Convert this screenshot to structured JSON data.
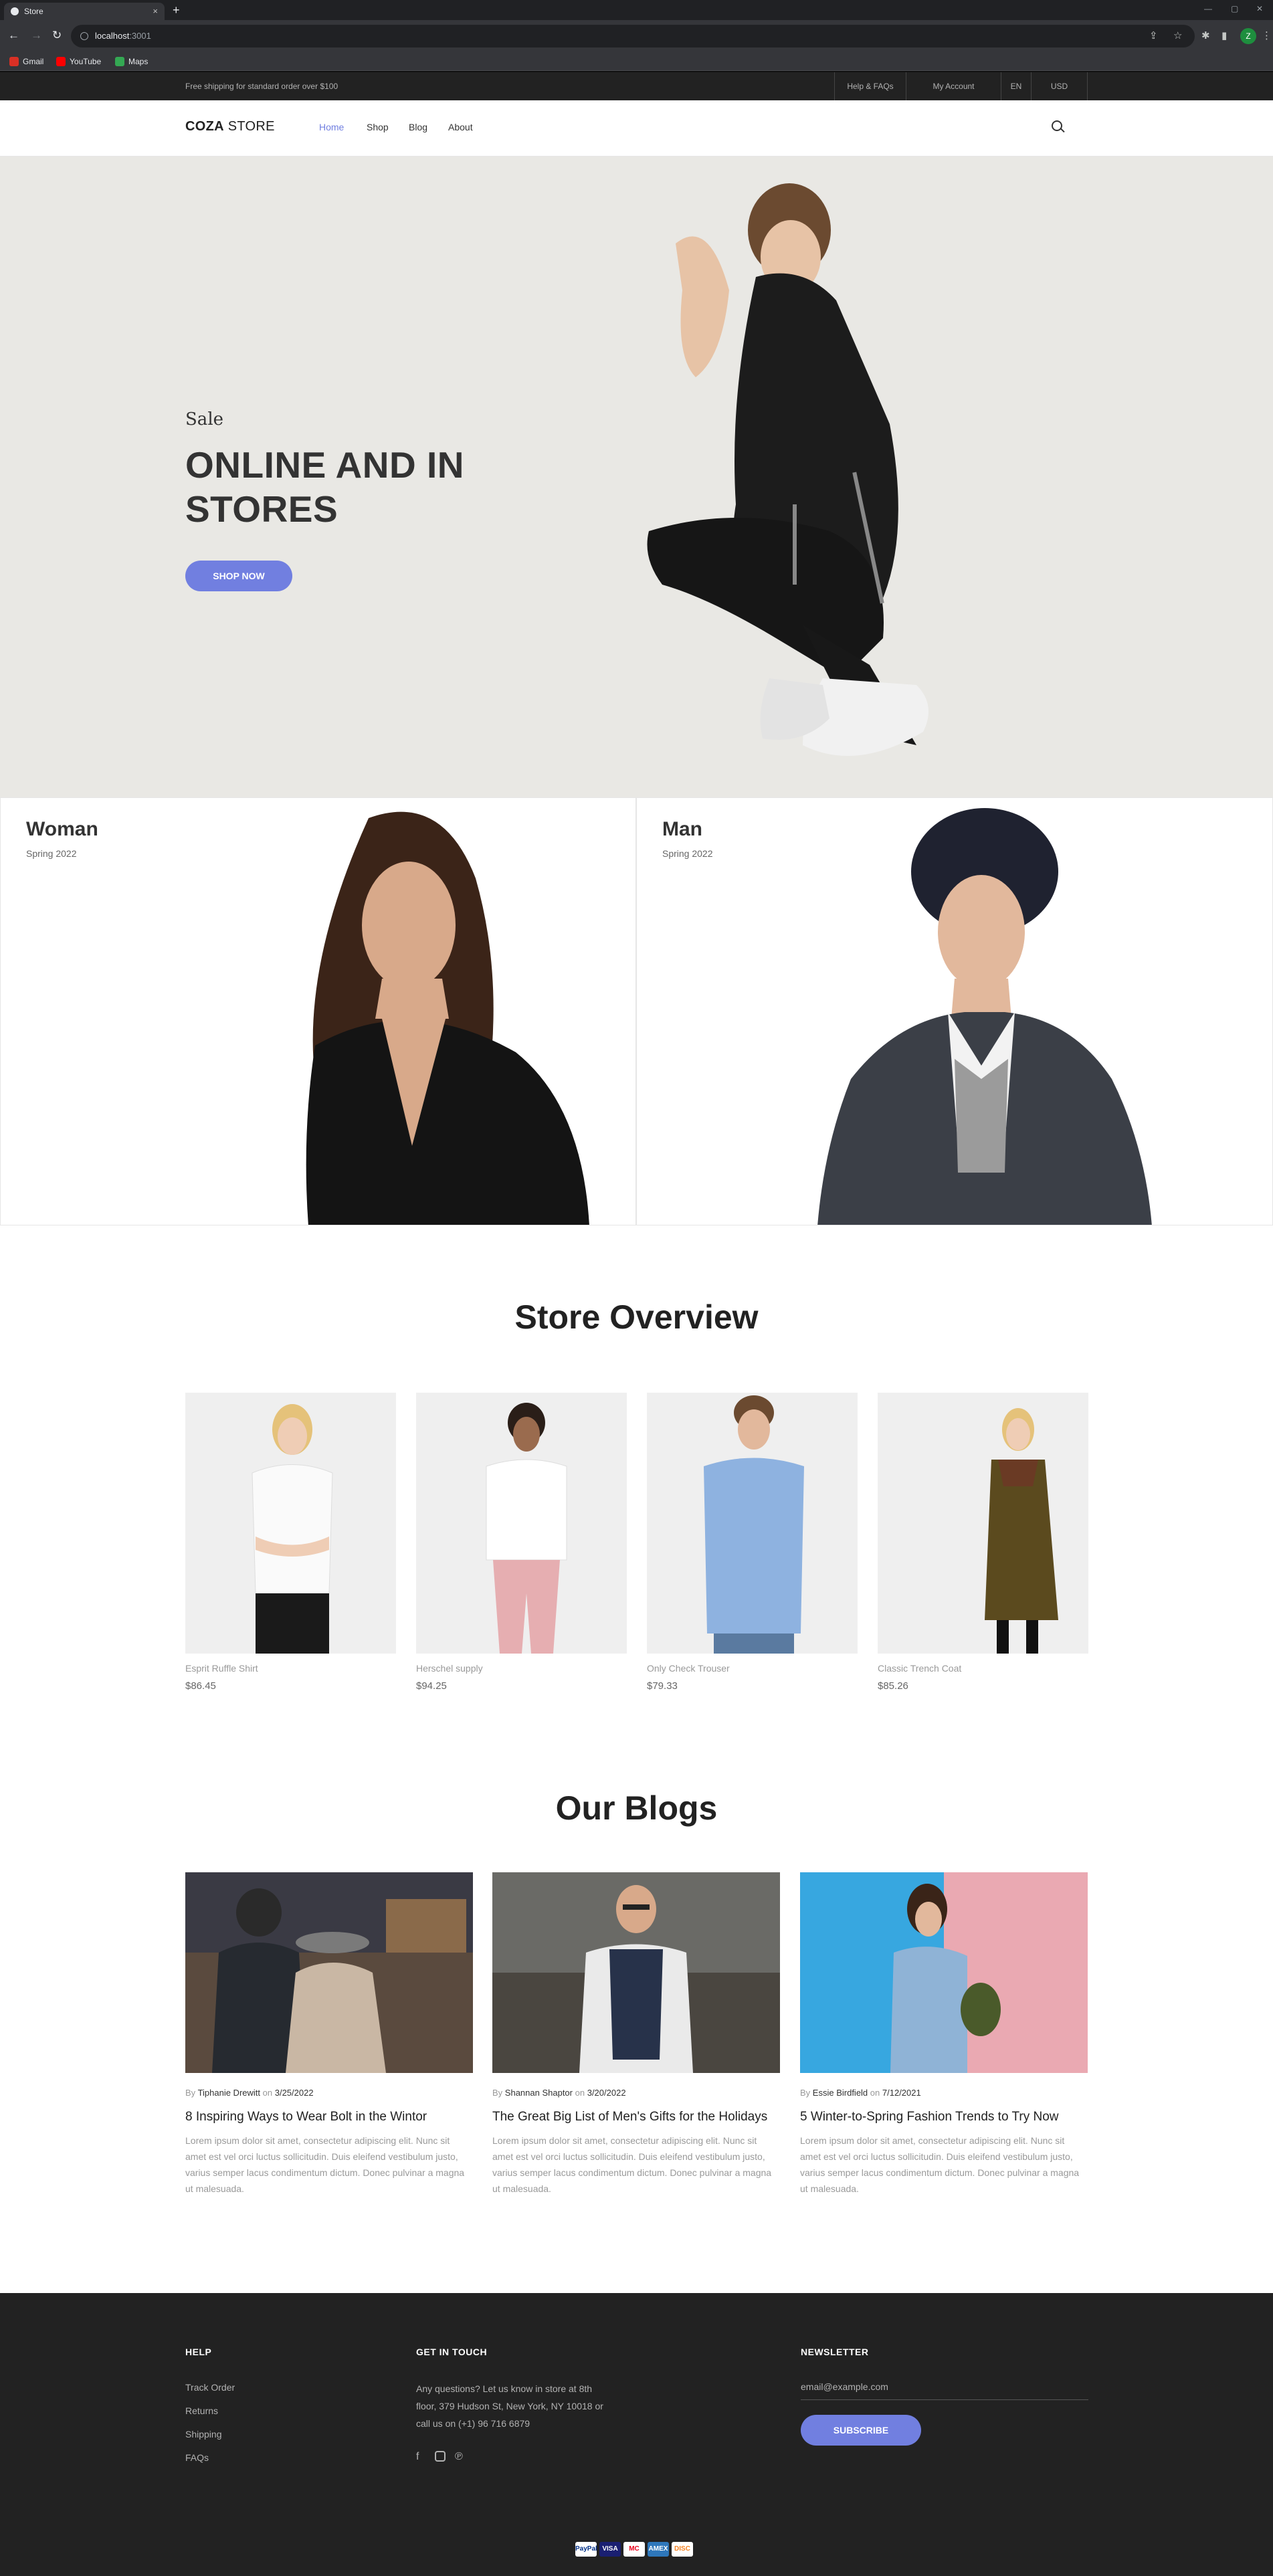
{
  "browser": {
    "tab_title": "Store",
    "tab_close": "×",
    "new_tab": "+",
    "url_host": "localhost",
    "url_port": ":3001",
    "profile_initial": "Z",
    "bookmarks": [
      {
        "label": "Gmail",
        "color": "#d93025"
      },
      {
        "label": "YouTube",
        "color": "#ff0000"
      },
      {
        "label": "Maps",
        "color": "#34a853"
      }
    ]
  },
  "topbar": {
    "shipping": "Free shipping for standard order over $100",
    "links": [
      "Help & FAQs",
      "My Account",
      "EN",
      "USD"
    ]
  },
  "header": {
    "logo_bold": "COZA",
    "logo_rest": " STORE",
    "nav": [
      "Home",
      "Shop",
      "Blog",
      "About"
    ],
    "active_nav": "Home"
  },
  "hero": {
    "subtitle": "Sale",
    "title": "ONLINE AND IN STORES",
    "button": "SHOP NOW"
  },
  "banners": [
    {
      "title": "Woman",
      "subtitle": "Spring 2022"
    },
    {
      "title": "Man",
      "subtitle": "Spring 2022"
    }
  ],
  "overview": {
    "title": "Store Overview",
    "products": [
      {
        "name": "Esprit Ruffle Shirt",
        "price": "$86.45"
      },
      {
        "name": "Herschel supply",
        "price": "$94.25"
      },
      {
        "name": "Only Check Trouser",
        "price": "$79.33"
      },
      {
        "name": "Classic Trench Coat",
        "price": "$85.26"
      }
    ]
  },
  "blogs": {
    "title": "Our Blogs",
    "by": "By",
    "on": "on",
    "items": [
      {
        "author": "Tiphanie Drewitt",
        "date": "3/25/2022",
        "title": "8 Inspiring Ways to Wear Bolt in the Wintor",
        "desc": "Lorem ipsum dolor sit amet, consectetur adipiscing elit. Nunc sit amet est vel orci luctus sollicitudin. Duis eleifend vestibulum justo, varius semper lacus condimentum dictum. Donec pulvinar a magna ut malesuada."
      },
      {
        "author": "Shannan Shaptor",
        "date": "3/20/2022",
        "title": "The Great Big List of Men's Gifts for the Holidays",
        "desc": "Lorem ipsum dolor sit amet, consectetur adipiscing elit. Nunc sit amet est vel orci luctus sollicitudin. Duis eleifend vestibulum justo, varius semper lacus condimentum dictum. Donec pulvinar a magna ut malesuada."
      },
      {
        "author": "Essie Birdfield",
        "date": "7/12/2021",
        "title": "5 Winter-to-Spring Fashion Trends to Try Now",
        "desc": "Lorem ipsum dolor sit amet, consectetur adipiscing elit. Nunc sit amet est vel orci luctus sollicitudin. Duis eleifend vestibulum justo, varius semper lacus condimentum dictum. Donec pulvinar a magna ut malesuada."
      }
    ]
  },
  "footer": {
    "help_title": "HELP",
    "help_links": [
      "Track Order",
      "Returns",
      "Shipping",
      "FAQs"
    ],
    "contact_title": "GET IN TOUCH",
    "contact_text": "Any questions? Let us know in store at 8th floor, 379 Hudson St, New York, NY 10018 or call us on (+1) 96 716 6879",
    "social_icons": [
      "facebook-icon",
      "instagram-icon",
      "pinterest-icon"
    ],
    "newsletter_title": "NEWSLETTER",
    "email_placeholder": "email@example.com",
    "subscribe": "SUBSCRIBE",
    "payments": [
      {
        "label": "PayPal",
        "bg": "#ffffff",
        "fg": "#003087"
      },
      {
        "label": "VISA",
        "bg": "#1a1f71",
        "fg": "#ffffff"
      },
      {
        "label": "MC",
        "bg": "#ffffff",
        "fg": "#eb001b"
      },
      {
        "label": "AMEX",
        "bg": "#2e77bb",
        "fg": "#ffffff"
      },
      {
        "label": "DISC",
        "bg": "#ffffff",
        "fg": "#f48120"
      }
    ]
  },
  "colors": {
    "accent": "#717fe0",
    "topbar": "#222222",
    "footer": "#222222",
    "hero_bg": "#e9e8e4"
  }
}
